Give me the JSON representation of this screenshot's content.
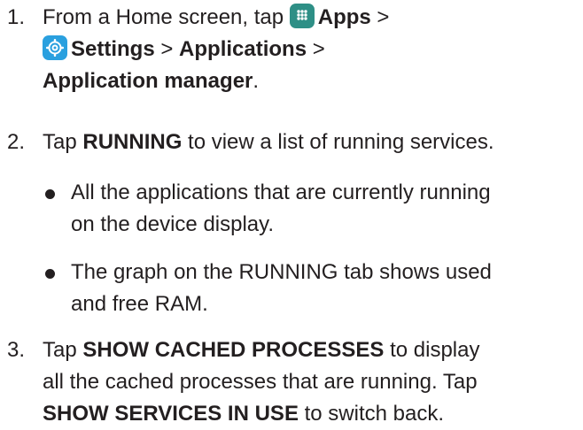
{
  "steps": [
    {
      "number": "1.",
      "prefix": "From a Home screen, tap ",
      "apps_label": "Apps",
      "sep1": " >",
      "settings_label": "Settings",
      "sep2": " > ",
      "applications_label": "Applications",
      "sep3": " >",
      "app_manager_label": "Application manager",
      "end": "."
    },
    {
      "number": "2.",
      "prefix": "Tap ",
      "running_label": "RUNNING",
      "suffix": " to view a list of running services.",
      "bullets": [
        {
          "line1": "All the applications that are currently running",
          "line2": "on the device display."
        },
        {
          "line1": "The graph on the RUNNING tab shows used",
          "line2": "and free RAM."
        }
      ]
    },
    {
      "number": "3.",
      "prefix": "Tap ",
      "cached_label": "SHOW CACHED PROCESSES",
      "mid": " to display",
      "line2": "all the cached processes that are running. Tap",
      "services_label": "SHOW SERVICES IN USE",
      "end": " to switch back."
    }
  ],
  "icons": {
    "apps": "apps-grid-icon",
    "settings": "settings-gear-icon"
  },
  "colors": {
    "text": "#231f20",
    "apps_icon_bg": "#2e8f86",
    "settings_icon_bg": "#2aa0df"
  }
}
